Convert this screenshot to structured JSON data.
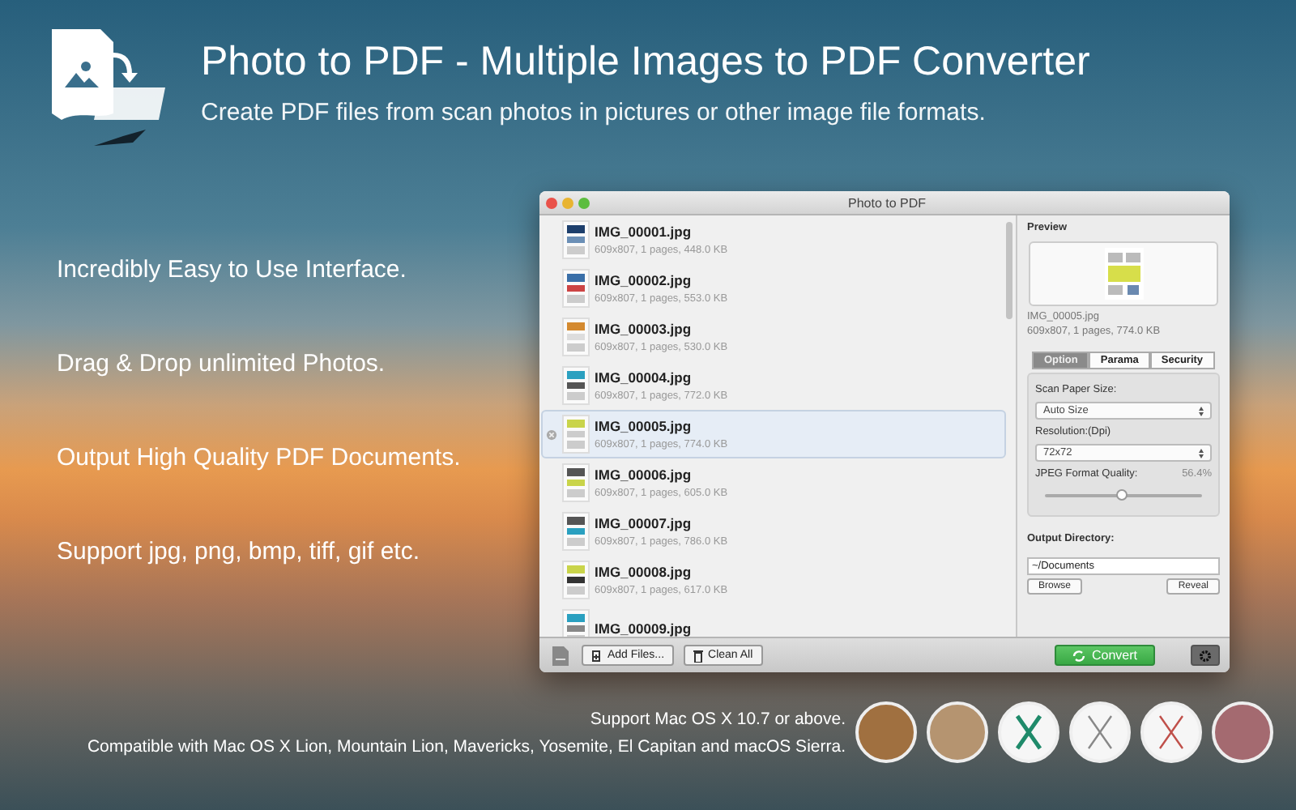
{
  "header": {
    "title": "Photo to PDF - Multiple Images to PDF Converter",
    "subtitle": "Create PDF files from scan photos in pictures or other image file formats."
  },
  "features": [
    "Incredibly Easy to Use Interface.",
    "Drag & Drop unlimited Photos.",
    "Output High Quality PDF Documents.",
    "Support jpg, png, bmp, tiff, gif etc."
  ],
  "window": {
    "title": "Photo to PDF",
    "files": [
      {
        "name": "IMG_00001.jpg",
        "info": "609x807, 1 pages, 448.0 KB",
        "selected": false
      },
      {
        "name": "IMG_00002.jpg",
        "info": "609x807, 1 pages, 553.0 KB",
        "selected": false
      },
      {
        "name": "IMG_00003.jpg",
        "info": "609x807, 1 pages, 530.0 KB",
        "selected": false
      },
      {
        "name": "IMG_00004.jpg",
        "info": "609x807, 1 pages, 772.0 KB",
        "selected": false
      },
      {
        "name": "IMG_00005.jpg",
        "info": "609x807, 1 pages, 774.0 KB",
        "selected": true
      },
      {
        "name": "IMG_00006.jpg",
        "info": "609x807, 1 pages, 605.0 KB",
        "selected": false
      },
      {
        "name": "IMG_00007.jpg",
        "info": "609x807, 1 pages, 786.0 KB",
        "selected": false
      },
      {
        "name": "IMG_00008.jpg",
        "info": "609x807, 1 pages, 617.0 KB",
        "selected": false
      },
      {
        "name": "IMG_00009.jpg",
        "selected": false
      }
    ],
    "preview": {
      "label": "Preview",
      "file_name": "IMG_00005.jpg",
      "file_info": "609x807, 1 pages, 774.0 KB"
    },
    "tabs": [
      {
        "label": "Option",
        "selected": true
      },
      {
        "label": "Parama",
        "selected": false
      },
      {
        "label": "Security",
        "selected": false
      }
    ],
    "paper": {
      "label": "Scan Paper Size:",
      "value": "Auto Size"
    },
    "resolution": {
      "label": "Resolution:(Dpi)",
      "value": "72x72"
    },
    "quality": {
      "label": "JPEG Format Quality:",
      "reading": "56.4%",
      "level": 0.48
    },
    "output": {
      "label": "Output Directory:",
      "value": "~/Documents",
      "buttons": [
        "Browse",
        "Reveal"
      ]
    },
    "toolbar": {
      "add": "Add Files...",
      "clear": "Clean All",
      "convert": "Convert"
    }
  },
  "footer": [
    "Support Mac OS X 10.7 or above.",
    "Compatible with Mac OS X Lion, Mountain Lion, Mavericks, Yosemite, El Capitan and macOS Sierra."
  ]
}
